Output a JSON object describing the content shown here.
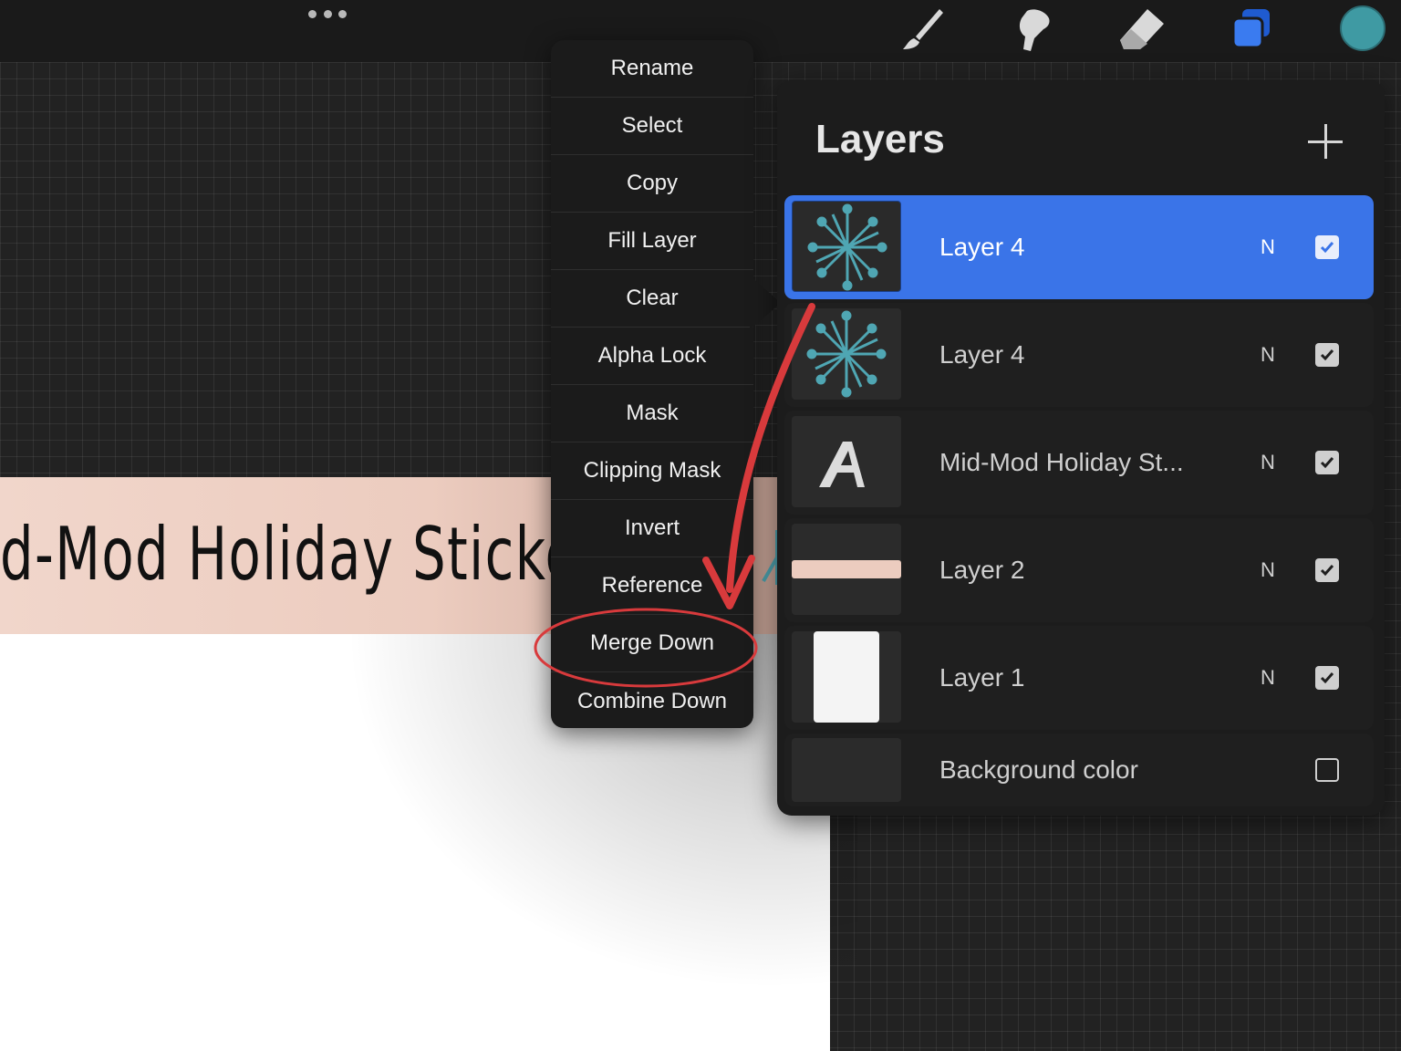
{
  "topbar": {
    "tools": [
      "more-actions-icon",
      "brush-icon",
      "smudge-icon",
      "eraser-icon",
      "layers-icon"
    ],
    "current_color": "#3f9aa3",
    "active_tool_color": "#2f6fe6"
  },
  "canvas": {
    "banner_text": "d-Mod Holiday Sticke",
    "banner_color": "#ecccbf",
    "starburst_color": "#4fa6b3"
  },
  "context_menu": {
    "items": [
      "Rename",
      "Select",
      "Copy",
      "Fill Layer",
      "Clear",
      "Alpha Lock",
      "Mask",
      "Clipping Mask",
      "Invert",
      "Reference",
      "Merge Down",
      "Combine Down"
    ],
    "highlighted": "Merge Down"
  },
  "layers_panel": {
    "title": "Layers",
    "add_icon": "plus-icon",
    "layers": [
      {
        "name": "Layer 4",
        "blend": "N",
        "visible": true,
        "selected": true,
        "thumb": "starburst"
      },
      {
        "name": "Layer 4",
        "blend": "N",
        "visible": true,
        "selected": false,
        "thumb": "starburst"
      },
      {
        "name": "Mid-Mod Holiday St...",
        "blend": "N",
        "visible": true,
        "selected": false,
        "thumb": "text"
      },
      {
        "name": "Layer 2",
        "blend": "N",
        "visible": true,
        "selected": false,
        "thumb": "banner"
      },
      {
        "name": "Layer 1",
        "blend": "N",
        "visible": true,
        "selected": false,
        "thumb": "paper"
      }
    ],
    "background": {
      "name": "Background color",
      "visible": false
    },
    "selected_color": "#3a74e8"
  },
  "annotation": {
    "arrow_color": "#d83a3c"
  }
}
